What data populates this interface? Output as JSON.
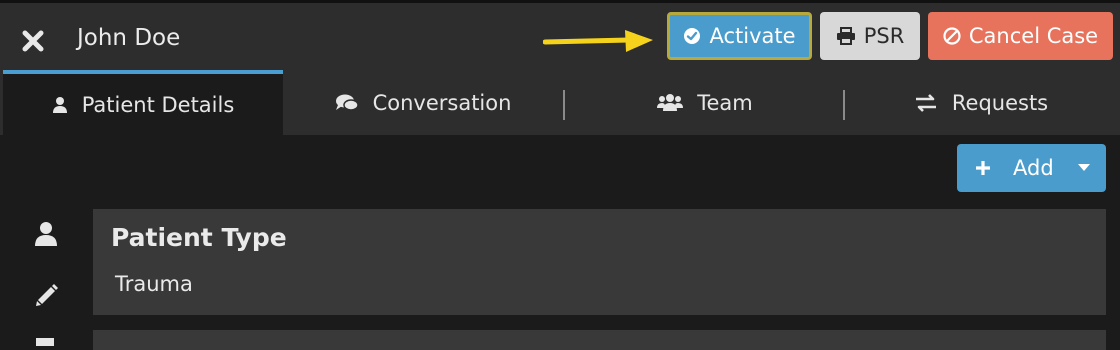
{
  "header": {
    "title": "John Doe",
    "close_icon": "close-icon",
    "buttons": {
      "activate": "Activate",
      "psr": "PSR",
      "cancel": "Cancel Case"
    }
  },
  "tabs": [
    {
      "label": "Patient Details",
      "icon": "user-icon",
      "active": true
    },
    {
      "label": "Conversation",
      "icon": "comments-icon",
      "active": false
    },
    {
      "label": "Team",
      "icon": "users-icon",
      "active": false
    },
    {
      "label": "Requests",
      "icon": "exchange-icon",
      "active": false
    }
  ],
  "toolbar": {
    "add_label": "Add"
  },
  "sidebar": {
    "icons": [
      "user-icon",
      "pencil-icon",
      "document-icon"
    ]
  },
  "card": {
    "title": "Patient Type",
    "value": "Trauma"
  },
  "colors": {
    "accent": "#4a9ccd",
    "danger": "#e8735c",
    "annotation_arrow": "#f5d31c"
  }
}
